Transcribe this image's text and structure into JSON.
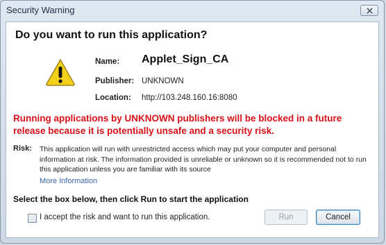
{
  "window": {
    "title": "Security Warning",
    "close_icon": "close-icon"
  },
  "heading": "Do you want to run this application?",
  "icon": {
    "name": "warning-icon",
    "color": "#f3d11a"
  },
  "details": {
    "name_label": "Name:",
    "name_value": "Applet_Sign_CA",
    "publisher_label": "Publisher:",
    "publisher_value": "UNKNOWN",
    "location_label": "Location:",
    "location_value": "http://103.248.160.16:8080"
  },
  "warning_text": "Running applications by UNKNOWN publishers will be blocked in a future release because it is potentially unsafe and a security risk.",
  "risk": {
    "label": "Risk:",
    "text": "This application will run with unrestricted access which may put your computer and personal information at risk. The information provided is unreliable or unknown so it is recommended not to run this application unless you are familiar with its source",
    "more_info": "More Information"
  },
  "instruction": "Select the box below, then click Run to start the application",
  "accept_checkbox": {
    "label": "I accept the risk and want to run this application.",
    "checked": false
  },
  "buttons": {
    "run": "Run",
    "cancel": "Cancel"
  },
  "colors": {
    "warning_red": "#d80f17",
    "link_blue": "#3a63a8"
  }
}
